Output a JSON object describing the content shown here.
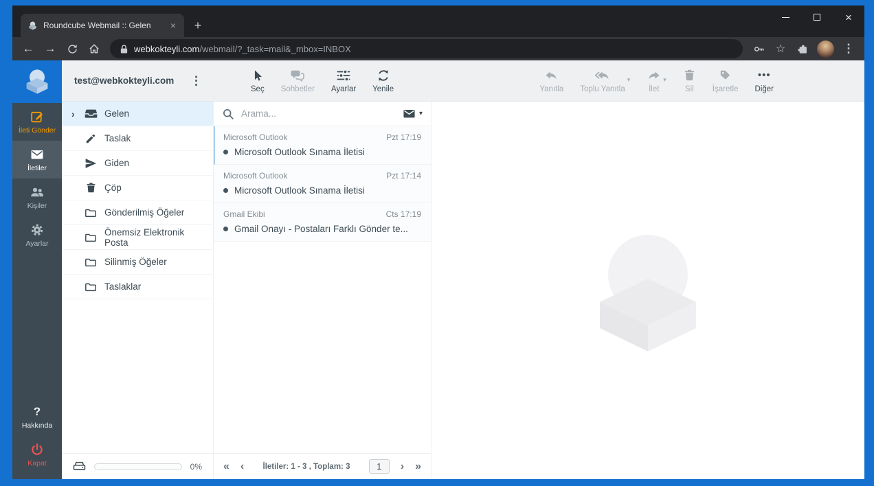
{
  "window": {
    "tab_title": "Roundcube Webmail :: Gelen"
  },
  "browser": {
    "url_host": "webkokteyli.com",
    "url_path": "/webmail/?_task=mail&_mbox=INBOX"
  },
  "taskbar": {
    "compose_label": "İleti Gönder",
    "mail_label": "İletiler",
    "contacts_label": "Kişiler",
    "settings_label": "Ayarlar",
    "about_label": "Hakkında",
    "logout_label": "Kapat"
  },
  "folders": {
    "account": "test@webkokteyli.com",
    "items": [
      {
        "label": "Gelen",
        "icon": "inbox-icon"
      },
      {
        "label": "Taslak",
        "icon": "pencil-icon"
      },
      {
        "label": "Giden",
        "icon": "send-icon"
      },
      {
        "label": "Çöp",
        "icon": "trash-icon"
      },
      {
        "label": "Gönderilmiş Öğeler",
        "icon": "folder-icon"
      },
      {
        "label": "Önemsiz Elektronik Posta",
        "icon": "folder-icon"
      },
      {
        "label": "Silinmiş Öğeler",
        "icon": "folder-icon"
      },
      {
        "label": "Taslaklar",
        "icon": "folder-icon"
      }
    ],
    "quota_percent": "0%"
  },
  "list_toolbar": {
    "select_label": "Seç",
    "chats_label": "Sohbetler",
    "options_label": "Ayarlar",
    "refresh_label": "Yenile"
  },
  "search": {
    "placeholder": "Arama..."
  },
  "messages": [
    {
      "sender": "Microsoft Outlook",
      "date": "Pzt 17:19",
      "subject": "Microsoft Outlook Sınama İletisi"
    },
    {
      "sender": "Microsoft Outlook",
      "date": "Pzt 17:14",
      "subject": "Microsoft Outlook Sınama İletisi"
    },
    {
      "sender": "Gmail Ekibi",
      "date": "Cts 17:19",
      "subject": "Gmail Onayı - Postaları Farklı Gönder te..."
    }
  ],
  "pagination": {
    "status": "İletiler: 1 - 3 , Toplam: 3",
    "current_page": "1"
  },
  "mail_toolbar": {
    "reply_label": "Yanıtla",
    "reply_all_label": "Toplu Yanıtla",
    "forward_label": "İlet",
    "delete_label": "Sil",
    "mark_label": "İşaretle",
    "more_label": "Diğer"
  },
  "glyphs": {
    "close": "×",
    "new_tab": "+",
    "back": "←",
    "forward": "→",
    "kebab": "⋮",
    "star": "☆",
    "chevron_right": "›",
    "chevron_down": "▾",
    "first_page": "«",
    "prev_page": "‹",
    "next_page": "›",
    "last_page": "»",
    "more_dots": "•••",
    "question": "?"
  },
  "colors": {
    "desktop": "#1471d0",
    "taskbar_bg": "#3d4a53",
    "compose_accent": "#f59b00",
    "logout_accent": "#ef5350",
    "selected_folder_bg": "#e2f1fb"
  }
}
